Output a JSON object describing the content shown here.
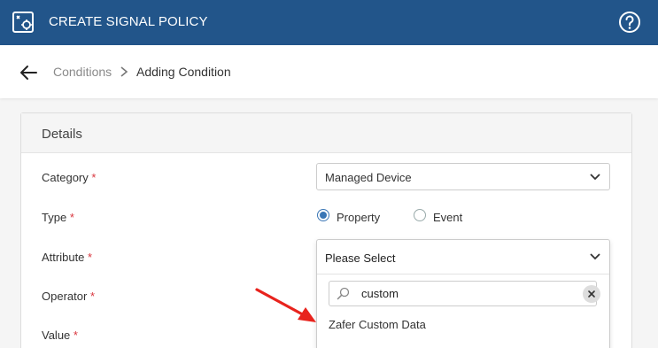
{
  "header": {
    "title": "CREATE SIGNAL POLICY",
    "app_icon": "policy-app-icon",
    "help_icon": "help-circle-icon",
    "bg_color": "#22558a"
  },
  "breadcrumb": {
    "back_icon": "arrow-left-icon",
    "items": [
      "Conditions",
      "Adding Condition"
    ]
  },
  "panel": {
    "title": "Details"
  },
  "form": {
    "required_marker": "*",
    "category": {
      "label": "Category",
      "value": "Managed Device"
    },
    "type": {
      "label": "Type",
      "options": [
        "Property",
        "Event"
      ],
      "selected": "Property"
    },
    "attribute": {
      "label": "Attribute",
      "value": "Please Select",
      "search_value": "custom",
      "options": [
        "Zafer Custom Data"
      ]
    },
    "operator": {
      "label": "Operator"
    },
    "value": {
      "label": "Value"
    }
  },
  "colors": {
    "accent": "#3a76b5",
    "required": "#d9363e",
    "annotation_arrow": "#e8231d"
  }
}
